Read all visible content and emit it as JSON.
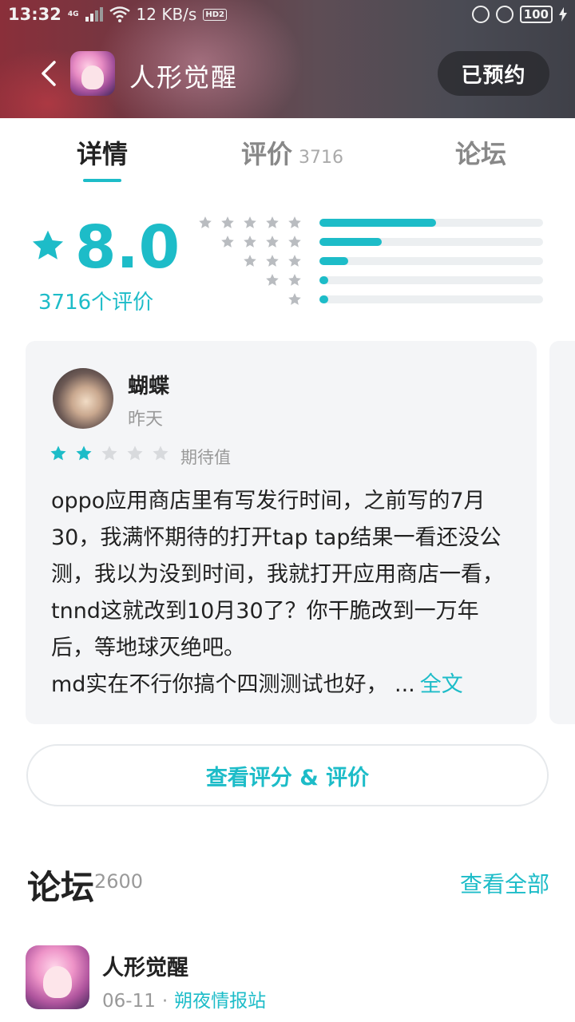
{
  "status_bar": {
    "time": "13:32",
    "net_label": "4G",
    "speed": "12 KB/s",
    "hd_label": "HD2",
    "battery": "100"
  },
  "nav": {
    "title": "人形觉醒",
    "reserved_label": "已预约"
  },
  "tabs": [
    {
      "label": "详情",
      "active": true
    },
    {
      "label": "评价",
      "count": "3716"
    },
    {
      "label": "论坛"
    }
  ],
  "rating": {
    "score": "8.0",
    "count_label": "3716个评价",
    "distribution": [
      {
        "stars": 5,
        "fraction": 0.52
      },
      {
        "stars": 4,
        "fraction": 0.28
      },
      {
        "stars": 3,
        "fraction": 0.13
      },
      {
        "stars": 2,
        "fraction": 0.04
      },
      {
        "stars": 1,
        "fraction": 0.04
      }
    ],
    "accent": "#1dbcc8"
  },
  "review": {
    "username": "蝴蝶",
    "time": "昨天",
    "stars": 2,
    "max_stars": 5,
    "tag": "期待值",
    "lines": [
      "oppo应用商店里有写发行时间，之前写的7月",
      "30，我满怀期待的打开tap tap结果一看还没公",
      "测，我以为没到时间，我就打开应用商店一看，",
      "tnnd这就改到10月30了？你干脆改到一万年",
      "后，等地球灭绝吧。",
      "md实在不行你搞个四测测试也好，  ..."
    ],
    "full_text_label": "全文"
  },
  "view_ratings_label": "查看评分 & 评价",
  "forum": {
    "title": "论坛",
    "count": "2600",
    "view_all_label": "查看全部",
    "post": {
      "title": "人形觉醒",
      "date": "06-11",
      "separator": "·",
      "source": "朔夜情报站"
    }
  }
}
